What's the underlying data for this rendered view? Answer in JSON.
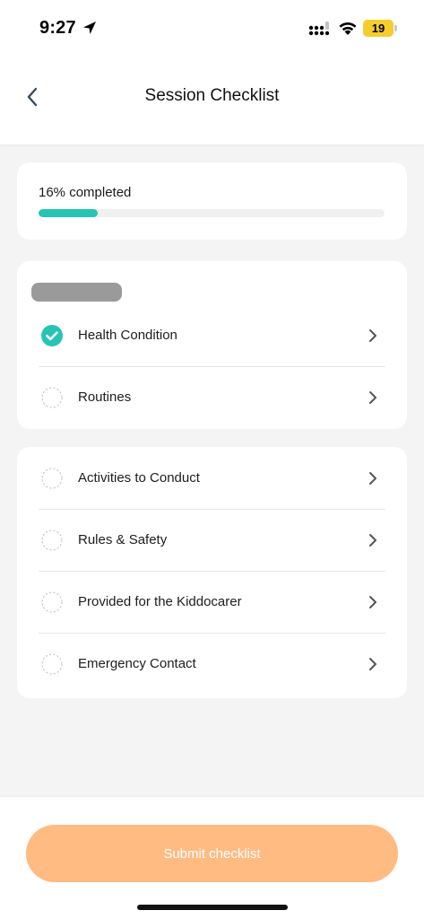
{
  "status_bar": {
    "time": "9:27",
    "battery_level": "19",
    "icons": [
      "location-arrow-icon",
      "cellular-signal-icon",
      "wifi-icon",
      "battery-icon"
    ]
  },
  "header": {
    "title": "Session Checklist",
    "back_icon": "chevron-left-icon"
  },
  "progress": {
    "label": "16% completed",
    "fraction": 0.17,
    "color": "#26c4b4"
  },
  "section_1": {
    "redacted_heading": "",
    "items": [
      {
        "label": "Health Condition",
        "completed": true
      },
      {
        "label": "Routines",
        "completed": false
      }
    ]
  },
  "section_2": {
    "items": [
      {
        "label": "Activities to Conduct",
        "completed": false
      },
      {
        "label": "Rules & Safety",
        "completed": false
      },
      {
        "label": "Provided for the Kiddocarer",
        "completed": false
      },
      {
        "label": "Emergency Contact",
        "completed": false
      }
    ]
  },
  "footer": {
    "submit_label": "Submit checklist",
    "submit_color": "#ffbb82"
  },
  "colors": {
    "accent": "#26c4b4",
    "background": "#f4f4f4",
    "divider": "#dfe9ea"
  }
}
